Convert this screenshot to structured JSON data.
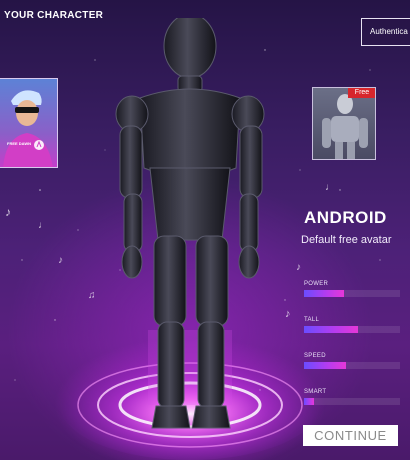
{
  "header": {
    "title": "YOUR CHARACTER",
    "auth_button_label": "Authentica"
  },
  "left_card": {
    "caption": "FREE DAWN"
  },
  "right_card": {
    "badge": "Free"
  },
  "character": {
    "name": "ANDROID",
    "description": "Default free avatar"
  },
  "stats": [
    {
      "label": "POWER",
      "level": 0.42
    },
    {
      "label": "TALL",
      "level": 0.56
    },
    {
      "label": "SPEED",
      "level": 0.44
    },
    {
      "label": "SMART",
      "level": 0.1
    }
  ],
  "footer": {
    "continue_label": "CONTINUE"
  },
  "colors": {
    "accent": "#b43cf0",
    "badge": "#d7262c",
    "bg": "#4d2178"
  }
}
